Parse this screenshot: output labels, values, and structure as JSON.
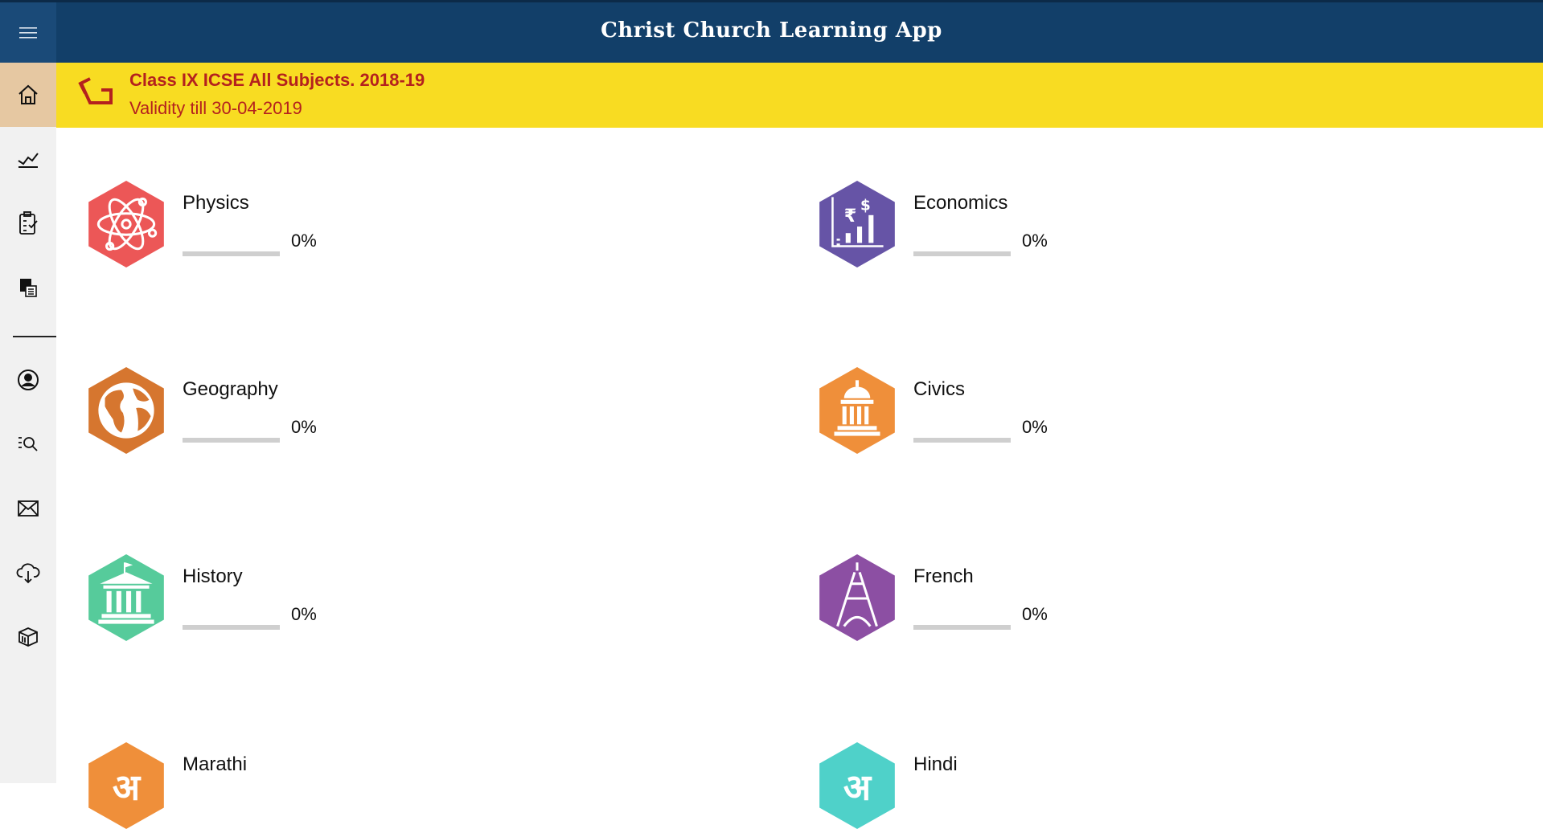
{
  "app": {
    "title": "Christ Church Learning App"
  },
  "banner": {
    "title": "Class IX ICSE All Subjects. 2018-19",
    "validity": "Validity till 30-04-2019",
    "icon": "back-arrow-icon"
  },
  "sidebar": {
    "items": [
      {
        "icon": "home-icon",
        "active": true
      },
      {
        "icon": "chart-line-icon",
        "active": false
      },
      {
        "icon": "clipboard-check-icon",
        "active": false
      },
      {
        "icon": "media-file-icon",
        "active": false
      },
      {
        "icon": "user-profile-icon",
        "active": false
      },
      {
        "icon": "search-list-icon",
        "active": false
      },
      {
        "icon": "mail-icon",
        "active": false
      },
      {
        "icon": "cloud-download-icon",
        "active": false
      },
      {
        "icon": "package-icon",
        "active": false
      }
    ]
  },
  "subjects": [
    {
      "name": "Physics",
      "percent": "0%",
      "progress": 0,
      "color": "#ec5757",
      "icon": "atom-icon"
    },
    {
      "name": "Economics",
      "percent": "0%",
      "progress": 0,
      "color": "#6654a6",
      "icon": "currency-chart-icon"
    },
    {
      "name": "Geography",
      "percent": "0%",
      "progress": 0,
      "color": "#d6762f",
      "icon": "globe-icon"
    },
    {
      "name": "Civics",
      "percent": "0%",
      "progress": 0,
      "color": "#ef8f3a",
      "icon": "capitol-icon"
    },
    {
      "name": "History",
      "percent": "0%",
      "progress": 0,
      "color": "#56cb9b",
      "icon": "museum-icon"
    },
    {
      "name": "French",
      "percent": "0%",
      "progress": 0,
      "color": "#8c4fa3",
      "icon": "eiffel-tower-icon"
    },
    {
      "name": "Marathi",
      "percent": "",
      "progress": 0,
      "color": "#ef8f3a",
      "icon": "devanagari-letter-icon"
    },
    {
      "name": "Hindi",
      "percent": "",
      "progress": 0,
      "color": "#4fd1c9",
      "icon": "devanagari-letter-icon"
    }
  ]
}
